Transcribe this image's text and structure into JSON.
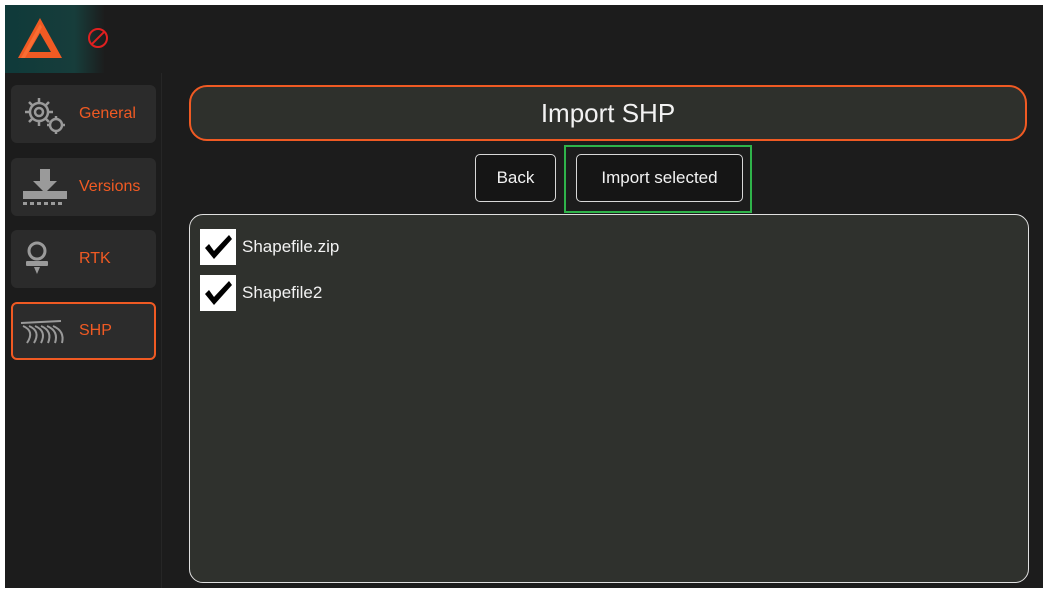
{
  "app": {
    "logo_icon": "triangle-logo-icon",
    "status_icon": "no-signal-icon",
    "accent_color": "#f05a23",
    "highlight_color": "#2fb34a"
  },
  "sidebar": {
    "items": [
      {
        "label": "General",
        "icon": "gear-icon",
        "active": false
      },
      {
        "label": "Versions",
        "icon": "download-icon",
        "active": false
      },
      {
        "label": "RTK",
        "icon": "rtk-antenna-icon",
        "active": false
      },
      {
        "label": "SHP",
        "icon": "field-rows-icon",
        "active": true
      }
    ]
  },
  "main": {
    "title": "Import SHP",
    "back_label": "Back",
    "import_label": "Import selected",
    "files": [
      {
        "name": "Shapefile.zip",
        "checked": true
      },
      {
        "name": "Shapefile2",
        "checked": true
      }
    ]
  }
}
